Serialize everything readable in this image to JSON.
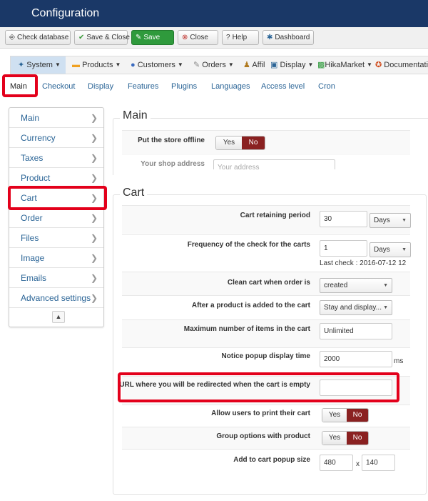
{
  "header": {
    "title": "Configuration"
  },
  "toolbar": {
    "check_database": "Check database",
    "save_close": "Save & Close",
    "save": "Save",
    "close": "Close",
    "help": "Help",
    "dashboard": "Dashboard"
  },
  "menubar": {
    "items": [
      {
        "label": "System"
      },
      {
        "label": "Products"
      },
      {
        "label": "Customers"
      },
      {
        "label": "Orders"
      },
      {
        "label": "Affil"
      },
      {
        "label": "Display"
      },
      {
        "label": "HikaMarket"
      },
      {
        "label": "Documentatio"
      }
    ]
  },
  "tabs": [
    "Main",
    "Checkout",
    "Display",
    "Features",
    "Plugins",
    "Languages",
    "Access level",
    "Cron"
  ],
  "sidebar": {
    "items": [
      "Main",
      "Currency",
      "Taxes",
      "Product",
      "Cart",
      "Order",
      "Files",
      "Image",
      "Emails",
      "Advanced settings"
    ],
    "collapse_symbol": "▲"
  },
  "main_section": {
    "legend": "Main",
    "offline_label": "Put the store offline",
    "offline_yes": "Yes",
    "offline_no": "No",
    "address_label": "Your shop address",
    "address_placeholder": "Your address"
  },
  "cart_section": {
    "legend": "Cart",
    "retaining_label": "Cart retaining period",
    "retaining_value": "30",
    "retaining_unit": "Days",
    "frequency_label": "Frequency of the check for the carts",
    "frequency_value": "1",
    "frequency_unit": "Days",
    "last_check": "Last check : 2016-07-12 12",
    "clean_label": "Clean cart when order is",
    "clean_value": "created",
    "after_add_label": "After a product is added to the cart",
    "after_add_value": "Stay and display...",
    "max_items_label": "Maximum number of items in the cart",
    "max_items_value": "Unlimited",
    "notice_label": "Notice popup display time",
    "notice_value": "2000",
    "notice_unit": "ms",
    "redirect_label": "URL where you will be redirected when the cart is empty",
    "redirect_value": "",
    "print_label": "Allow users to print their cart",
    "print_yes": "Yes",
    "print_no": "No",
    "group_label": "Group options with product",
    "group_yes": "Yes",
    "group_no": "No",
    "popup_size_label": "Add to cart popup size",
    "popup_width": "480",
    "popup_x": "x",
    "popup_height": "140"
  }
}
